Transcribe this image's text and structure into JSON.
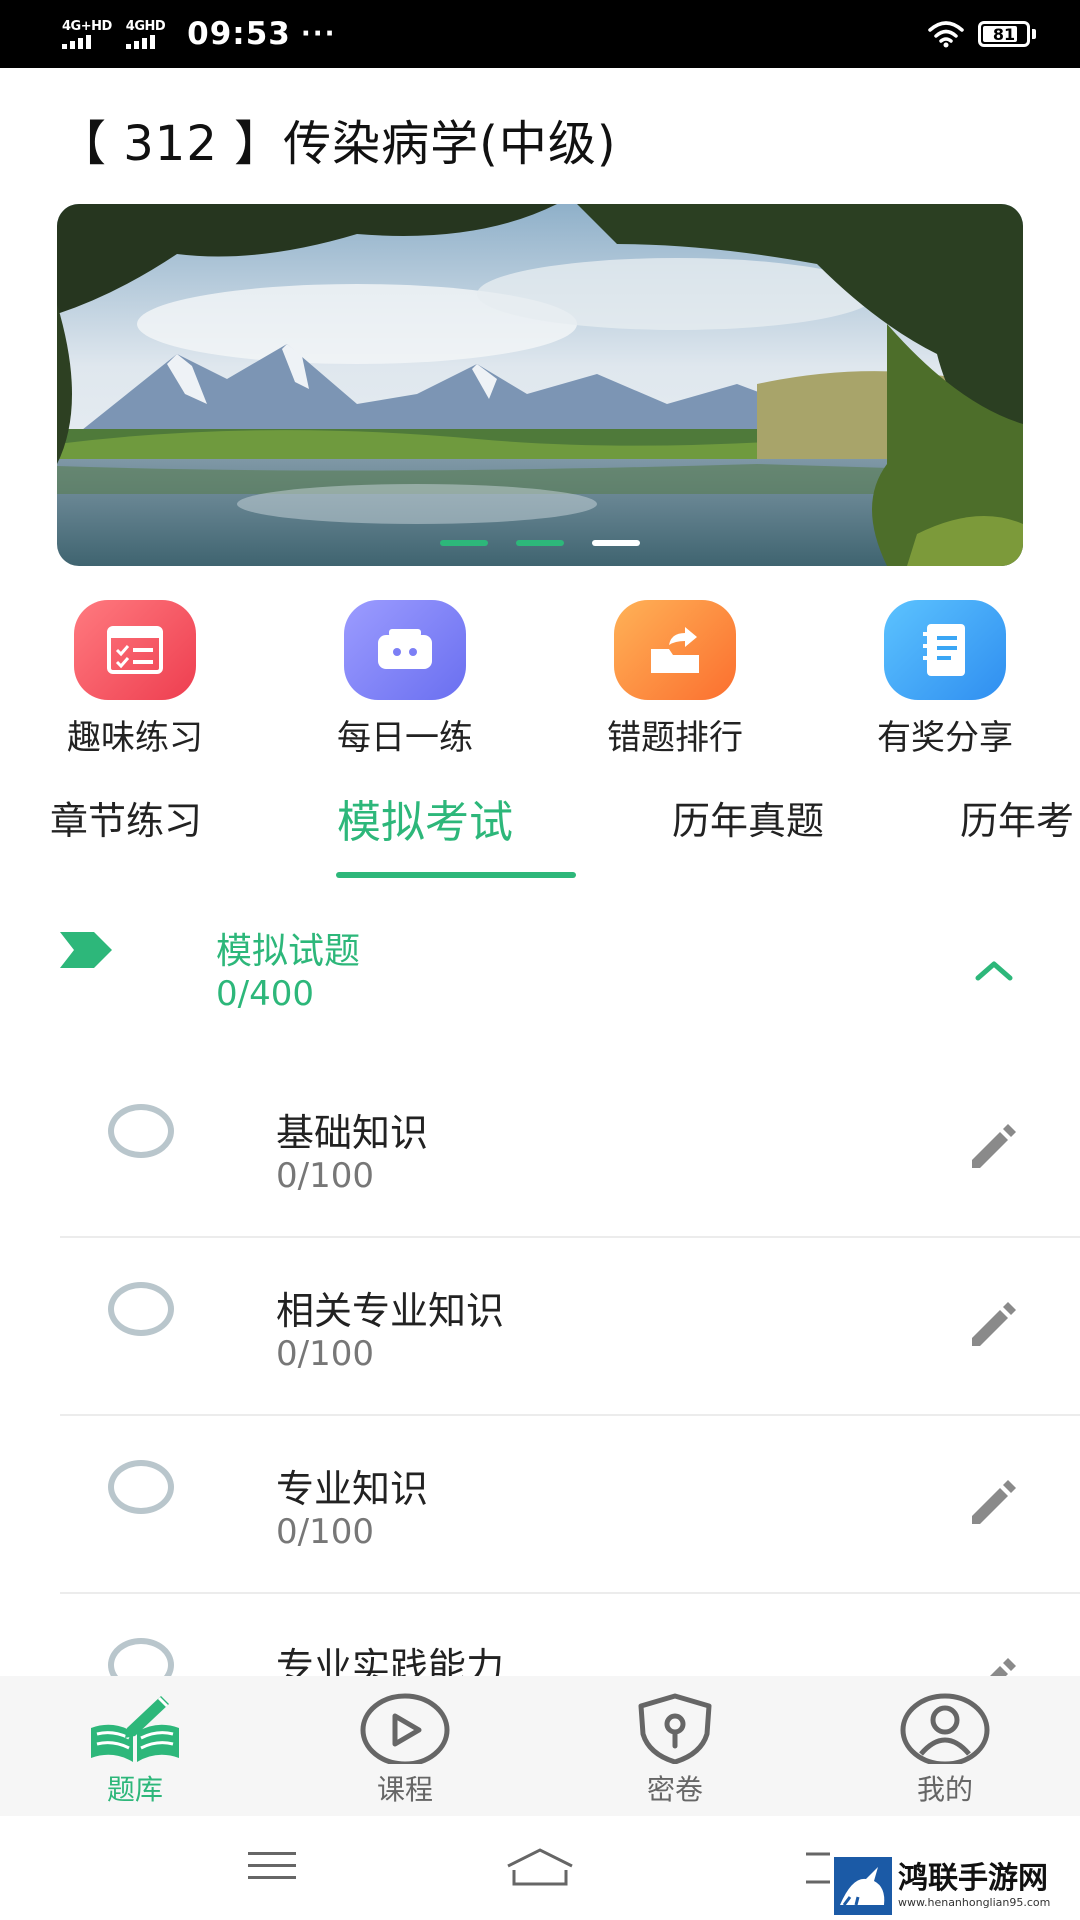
{
  "status_bar": {
    "sim1": "4G+HD",
    "sim2": "4GHD",
    "time": "09:53",
    "dots": "···",
    "battery": "81",
    "battery_level": 0.81
  },
  "page": {
    "title": "【 312 】传染病学(中级)"
  },
  "banner": {
    "slide_count": 3,
    "active_slide": 3
  },
  "quick_actions": [
    {
      "label": "趣味练习",
      "icon": "checklist-icon",
      "color": "#f0545e"
    },
    {
      "label": "每日一练",
      "icon": "radio-box-icon",
      "color": "#7c7ff5"
    },
    {
      "label": "错题排行",
      "icon": "share-box-icon",
      "color": "#fb8a3c"
    },
    {
      "label": "有奖分享",
      "icon": "notebook-icon",
      "color": "#3aa6f5"
    }
  ],
  "tabs": [
    {
      "label": "章节练习"
    },
    {
      "label": "模拟考试",
      "active": true
    },
    {
      "label": "历年真题"
    },
    {
      "label": "历年考"
    }
  ],
  "section": {
    "title": "模拟试题",
    "count": "0/400",
    "expanded": true
  },
  "items": [
    {
      "title": "基础知识",
      "count": "0/100"
    },
    {
      "title": "相关专业知识",
      "count": "0/100"
    },
    {
      "title": "专业知识",
      "count": "0/100"
    },
    {
      "title": "专业实践能力"
    }
  ],
  "bottom_nav": [
    {
      "label": "题库",
      "icon": "book-pen-icon",
      "active": true
    },
    {
      "label": "课程",
      "icon": "play-circle-icon"
    },
    {
      "label": "密卷",
      "icon": "shield-lock-icon"
    },
    {
      "label": "我的",
      "icon": "user-circle-icon"
    }
  ],
  "watermark": {
    "title": "鸿联手游网",
    "url": "www.henanhonglian95.com"
  },
  "colors": {
    "accent": "#2db77a",
    "divider": "#ececec",
    "radio": "#b9c6cc"
  }
}
